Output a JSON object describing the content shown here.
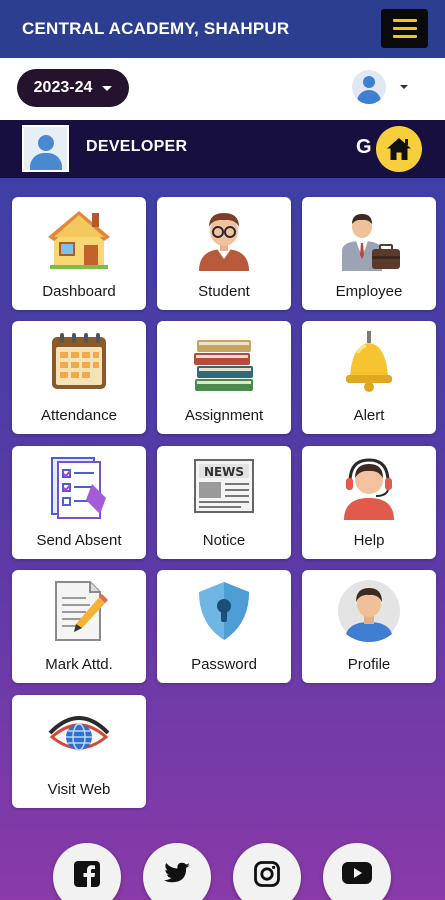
{
  "header": {
    "title": "CENTRAL ACADEMY, SHAHPUR"
  },
  "session": {
    "year": "2023-24"
  },
  "user": {
    "name": "DEVELOPER",
    "letter": "G"
  },
  "menu": [
    {
      "label": "Dashboard",
      "icon": "house-icon"
    },
    {
      "label": "Student",
      "icon": "student-icon"
    },
    {
      "label": "Employee",
      "icon": "employee-icon"
    },
    {
      "label": "Attendance",
      "icon": "calendar-icon"
    },
    {
      "label": "Assignment",
      "icon": "books-icon"
    },
    {
      "label": "Alert",
      "icon": "bell-icon"
    },
    {
      "label": "Send Absent",
      "icon": "absent-form-icon"
    },
    {
      "label": "Notice",
      "icon": "newspaper-icon"
    },
    {
      "label": "Help",
      "icon": "headset-icon"
    },
    {
      "label": "Mark Attd.",
      "icon": "clipboard-pencil-icon"
    },
    {
      "label": "Password",
      "icon": "shield-lock-icon"
    },
    {
      "label": "Profile",
      "icon": "profile-icon"
    },
    {
      "label": "Visit Web",
      "icon": "eye-globe-icon"
    }
  ],
  "social": [
    "facebook-icon",
    "twitter-icon",
    "instagram-icon",
    "youtube-icon"
  ],
  "colors": {
    "header": "#2c3e8f",
    "devbar": "#170f3f",
    "accent": "#f7cf3c",
    "year_pill": "#24122e"
  }
}
